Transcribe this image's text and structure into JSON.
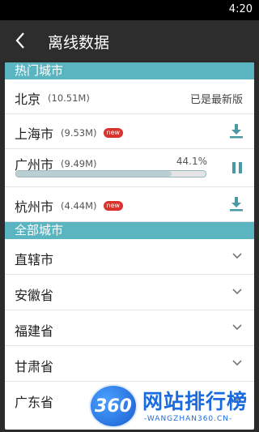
{
  "status_bar": {
    "time": "4:20"
  },
  "header": {
    "title": "离线数据",
    "back_icon": "back-chevron-icon"
  },
  "hot_section": {
    "title": "热门城市",
    "cities": [
      {
        "name": "北京",
        "size": "(10.51M)",
        "status": "已是最新版"
      },
      {
        "name": "上海市",
        "size": "(9.53M)",
        "badge": "new",
        "action_icon": "download-icon"
      },
      {
        "name": "广州市",
        "size": "(9.49M)",
        "progress_percent": "44.1%",
        "progress": 0.82,
        "action_icon": "pause-icon"
      },
      {
        "name": "杭州市",
        "size": "(4.44M)",
        "badge": "new",
        "action_icon": "download-icon"
      }
    ]
  },
  "all_section": {
    "title": "全部城市",
    "regions": [
      {
        "name": "直辖市"
      },
      {
        "name": "安徽省"
      },
      {
        "name": "福建省"
      },
      {
        "name": "甘肃省"
      },
      {
        "name": "广东省"
      }
    ]
  },
  "watermark": {
    "logo": "360",
    "title": "网站排行榜",
    "subtitle": "-WANGZHAN360.CN-"
  },
  "colors": {
    "accent": "#5bb5c0",
    "icon": "#4a9aa3",
    "badge": "#d9332b",
    "background": "#2b2b2b"
  }
}
